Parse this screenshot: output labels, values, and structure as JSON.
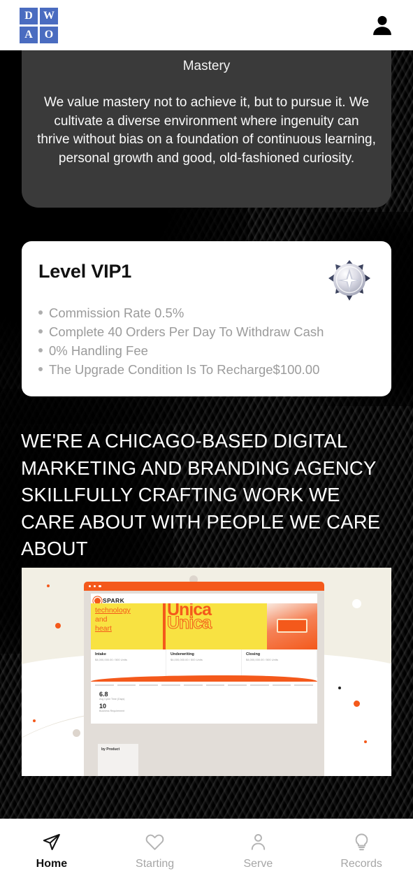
{
  "header": {
    "logo_letters": [
      "D",
      "W",
      "A",
      "O"
    ],
    "logo_color": "#4a6cc0",
    "avatar_icon": "user-avatar-icon"
  },
  "mastery_card": {
    "title": "Mastery",
    "body": "We value mastery not to achieve it, but to pursue it. We cultivate a diverse environment where ingenuity can thrive without bias on a foundation of continuous learning, personal growth and good, old-fashioned curiosity.",
    "background": "#3a3a3a"
  },
  "vip_card": {
    "title": "Level VIP1",
    "badge_icon": "vip-medal-star-icon",
    "benefits": [
      "Commission Rate 0.5%",
      "Complete 40 Orders Per Day To Withdraw Cash",
      "0% Handling Fee",
      "The Upgrade Condition Is To Recharge$100.00"
    ]
  },
  "headline": {
    "text": "WE'RE A CHICAGO-BASED DIGITAL MARKETING AND BRANDING AGENCY SKILLFULLY CRAFTING WORK WE CARE ABOUT WITH PEOPLE WE CARE ABOUT"
  },
  "portfolio_image": {
    "brand": "SPARK",
    "hero_lines": [
      "technology",
      "and",
      "heart"
    ],
    "display_word": "Unica",
    "cards": [
      {
        "title": "Intake",
        "lines": "$4,000,000.00 / 500 Units"
      },
      {
        "title": "Underwriting",
        "lines": "$4,000,000.00 / 500 Units"
      },
      {
        "title": "Closing",
        "lines": "$4,000,000.00 / 500 Units"
      }
    ],
    "stats": [
      {
        "value": "6.8",
        "label": "Avg Cycle Time (Days)"
      },
      {
        "value": "10",
        "label": "Business Requirement"
      }
    ],
    "section_label": "by Product",
    "accent_color": "#f4591b",
    "highlight_color": "#f8e242"
  },
  "bottom_nav": {
    "items": [
      {
        "label": "Home",
        "icon": "paper-plane-icon",
        "active": true
      },
      {
        "label": "Starting",
        "icon": "heart-icon",
        "active": false
      },
      {
        "label": "Serve",
        "icon": "person-icon",
        "active": false
      },
      {
        "label": "Records",
        "icon": "lightbulb-icon",
        "active": false
      }
    ]
  }
}
